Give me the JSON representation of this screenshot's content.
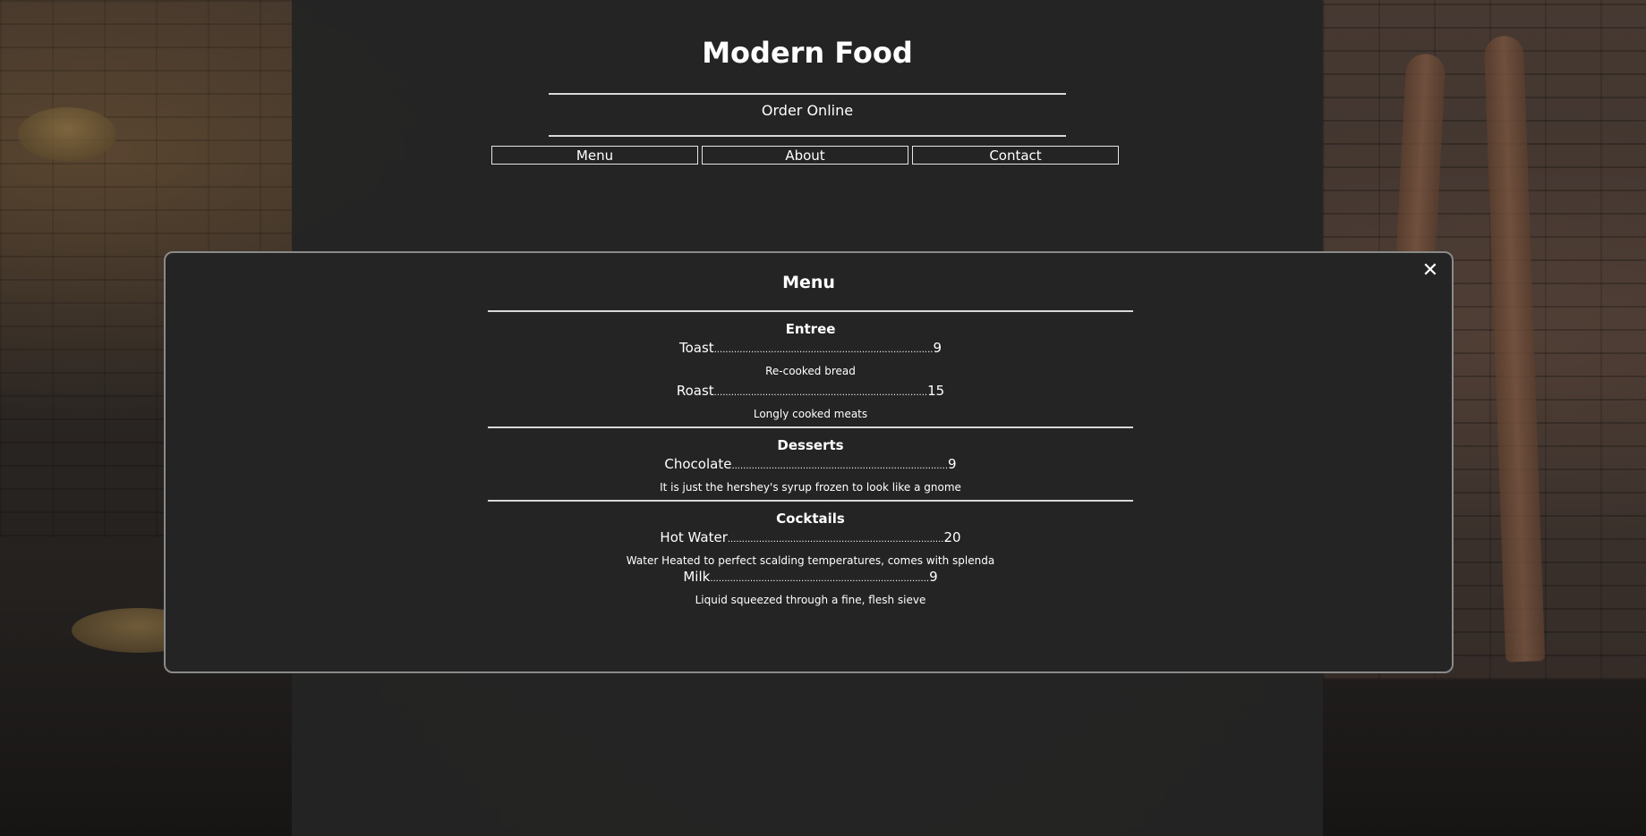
{
  "site": {
    "title": "Modern Food",
    "order_online": "Order Online"
  },
  "nav": {
    "items": [
      {
        "label": "Menu"
      },
      {
        "label": "About"
      },
      {
        "label": "Contact"
      }
    ]
  },
  "modal": {
    "title": "Menu",
    "close_symbol": "✕",
    "sections": [
      {
        "title": "Entree",
        "items": [
          {
            "name": "Toast",
            "price": "9",
            "description": "Re-cooked bread"
          },
          {
            "name": "Roast",
            "price": "15",
            "description": "Longly cooked meats"
          }
        ]
      },
      {
        "title": "Desserts",
        "items": [
          {
            "name": "Chocolate",
            "price": "9",
            "description": "It is just the hershey's syrup frozen to look like a gnome"
          }
        ]
      },
      {
        "title": "Cocktails",
        "items": [
          {
            "name": "Hot Water",
            "price": "20",
            "description": "Water Heated to perfect scalding temperatures, comes with splenda"
          },
          {
            "name": "Milk",
            "price": "9",
            "description": "Liquid squeezed through a fine, flesh sieve"
          }
        ]
      }
    ]
  },
  "theme": {
    "panel_color": "#242424",
    "text_color": "#ffffff",
    "rule_color": "#d8d8d8",
    "modal_border_color": "#8a8a8a"
  }
}
